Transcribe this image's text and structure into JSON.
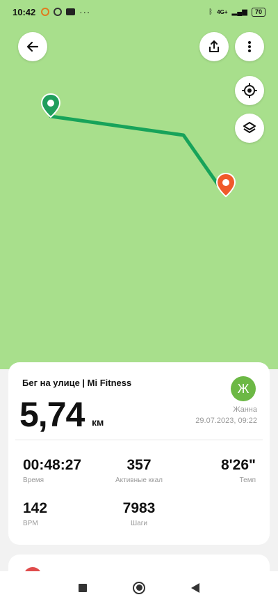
{
  "status_bar": {
    "time": "10:42",
    "notification_icons": [
      "ring-app-icon",
      "chrome-icon",
      "youtube-icon",
      "more-dots-icon"
    ],
    "right_icons": [
      "bluetooth-icon",
      "signal-icon"
    ],
    "network": "4G+",
    "battery": "70"
  },
  "map": {
    "background_color": "#a8df8c",
    "route_color": "#17a35a",
    "start_marker_color": "#1f9e5c",
    "end_marker_color": "#f05a2b"
  },
  "toolbar": {
    "back_icon": "arrow-left-icon",
    "share_icon": "share-icon",
    "more_icon": "more-vertical-icon",
    "locate_icon": "locate-icon",
    "layers_icon": "layers-icon"
  },
  "summary": {
    "activity_title": "Бег на улице | Mi Fitness",
    "distance": "5,74",
    "distance_unit": "км",
    "avatar_letter": "Ж",
    "user_name": "Жанна",
    "datetime": "29.07.2023, 09:22"
  },
  "stats": {
    "time": {
      "value": "00:48:27",
      "label": "Время"
    },
    "calories": {
      "value": "357",
      "label": "Активные ккал"
    },
    "pace": {
      "value": "8'26\"",
      "label": "Темп"
    },
    "bpm": {
      "value": "142",
      "label": "BPM"
    },
    "steps": {
      "value": "7983",
      "label": "Шаги"
    }
  },
  "nav_bar": {
    "items": [
      "recents-icon",
      "home-icon",
      "back-icon"
    ]
  }
}
